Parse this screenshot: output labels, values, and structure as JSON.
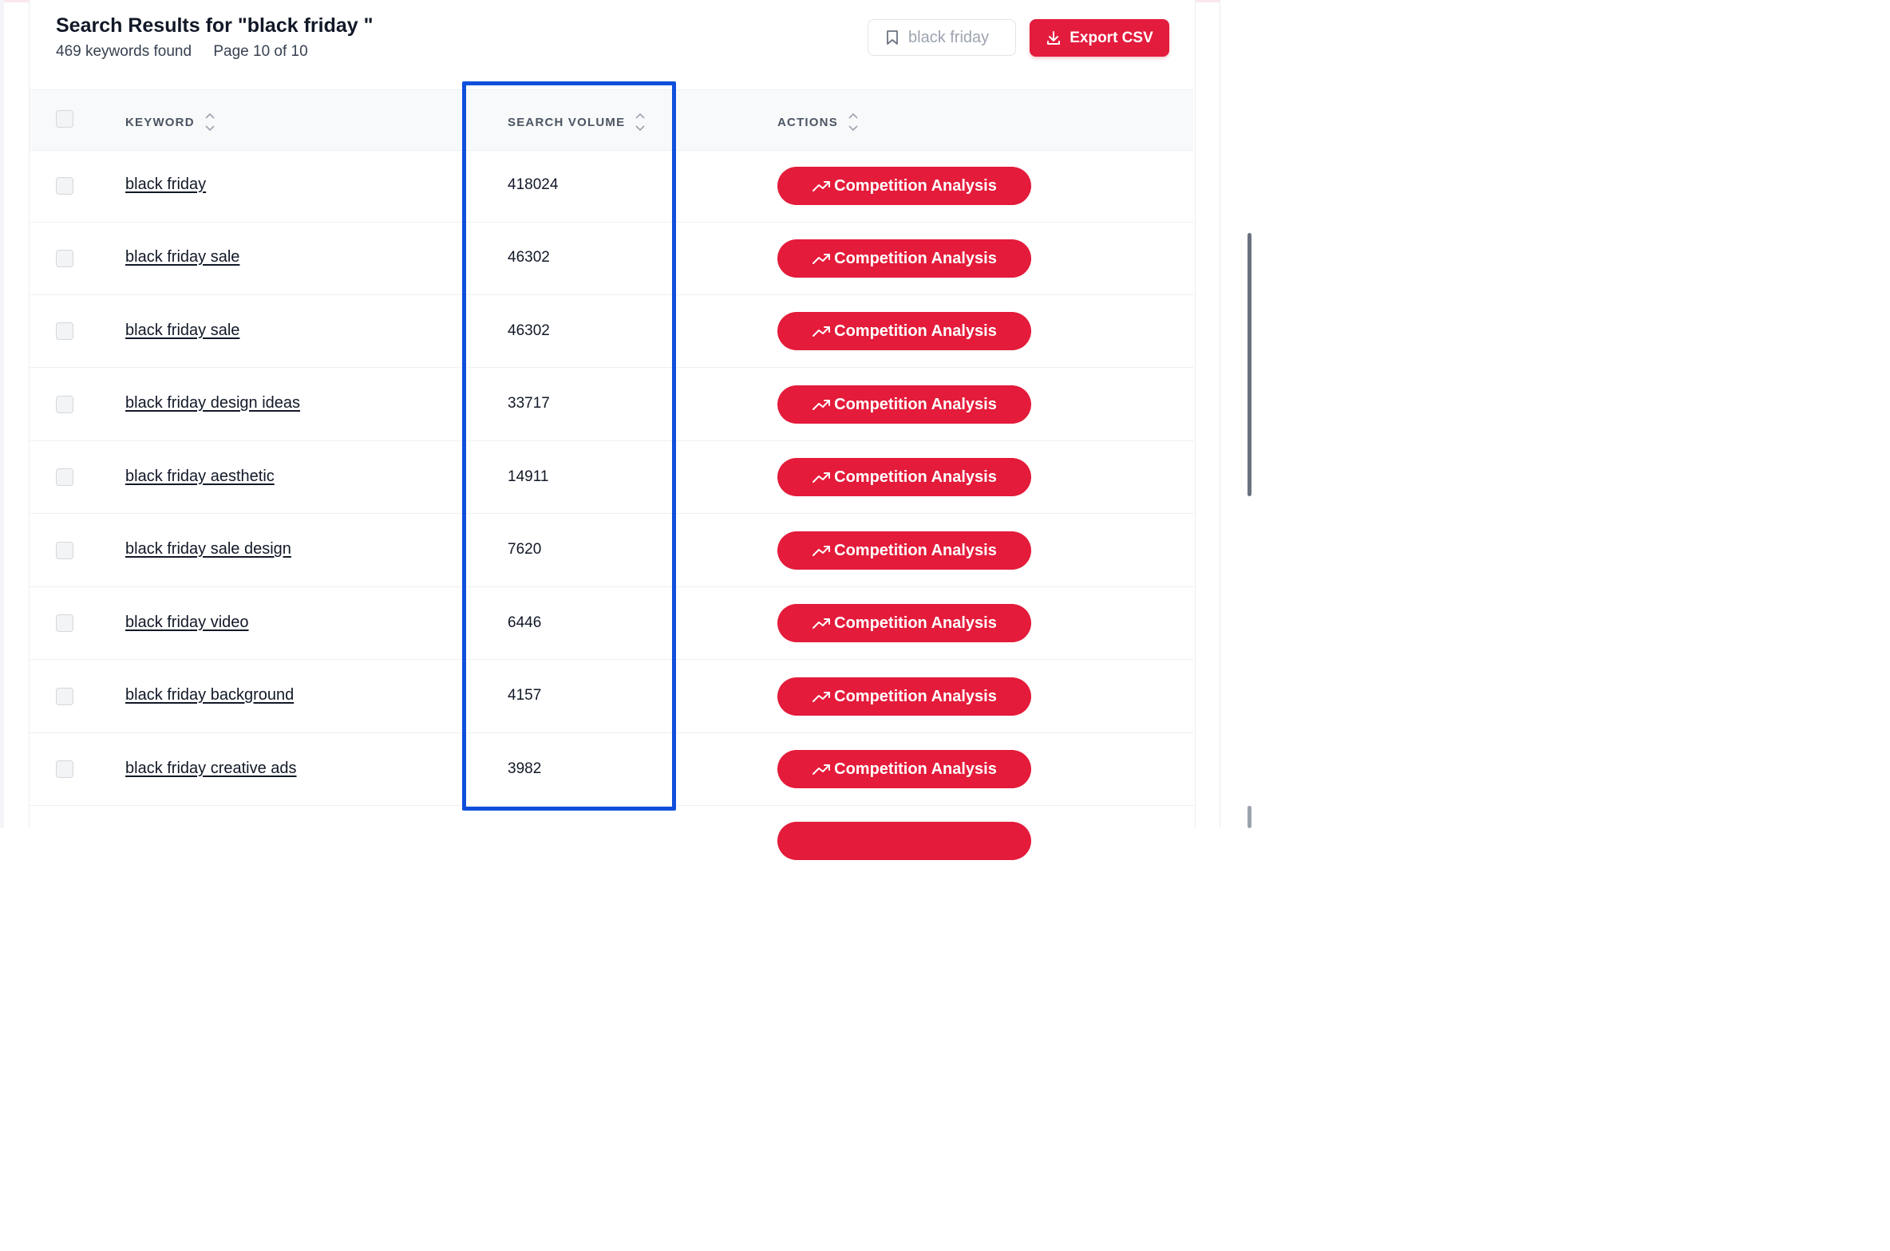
{
  "header": {
    "title": "Search Results for \"black friday \"",
    "keywords_found": "469 keywords found",
    "page_info": "Page 10 of 10",
    "saved_search_label": "black friday",
    "export_label": "Export CSV"
  },
  "table": {
    "columns": [
      "KEYWORD",
      "SEARCH VOLUME",
      "ACTIONS"
    ],
    "action_label": "Competition Analysis",
    "rows": [
      {
        "keyword": "black friday",
        "volume": "418024"
      },
      {
        "keyword": "black friday sale",
        "volume": "46302"
      },
      {
        "keyword": "black friday sale",
        "volume": "46302"
      },
      {
        "keyword": "black friday design ideas",
        "volume": "33717"
      },
      {
        "keyword": "black friday aesthetic",
        "volume": "14911"
      },
      {
        "keyword": "black friday sale design",
        "volume": "7620"
      },
      {
        "keyword": "black friday video",
        "volume": "6446"
      },
      {
        "keyword": "black friday background",
        "volume": "4157"
      },
      {
        "keyword": "black friday creative ads",
        "volume": "3982"
      }
    ]
  },
  "colors": {
    "accent": "#e41b3a",
    "highlight_box": "#0f4fdc"
  },
  "icons": {
    "saved": "bookmark-icon",
    "export": "download-icon",
    "action": "trending-up-icon",
    "sort": "sort-icon"
  }
}
